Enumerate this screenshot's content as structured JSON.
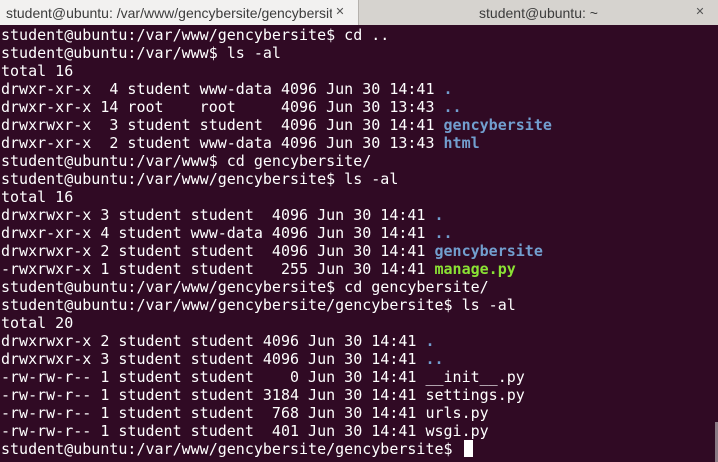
{
  "tabs": [
    {
      "label": "student@ubuntu: /var/www/gencybersite/gencybersite",
      "close": "✕",
      "active": true
    },
    {
      "label": "student@ubuntu: ~",
      "close": "✕",
      "active": false
    }
  ],
  "colors": {
    "background": "#300a24",
    "text": "#ffffff",
    "directory": "#729fcf",
    "executable": "#8ae234"
  },
  "terminal": {
    "lines": [
      {
        "type": "plain",
        "text": "student@ubuntu:/var/www/gencybersite$ cd .."
      },
      {
        "type": "plain",
        "text": "student@ubuntu:/var/www$ ls -al"
      },
      {
        "type": "plain",
        "text": "total 16"
      },
      {
        "type": "entry",
        "prefix": "drwxr-xr-x  4 student www-data 4096 Jun 30 14:41 ",
        "name": ".",
        "kind": "dir"
      },
      {
        "type": "entry",
        "prefix": "drwxr-xr-x 14 root    root     4096 Jun 30 13:43 ",
        "name": "..",
        "kind": "dir"
      },
      {
        "type": "entry",
        "prefix": "drwxrwxr-x  3 student student  4096 Jun 30 14:41 ",
        "name": "gencybersite",
        "kind": "dir"
      },
      {
        "type": "entry",
        "prefix": "drwxr-xr-x  2 student www-data 4096 Jun 30 13:43 ",
        "name": "html",
        "kind": "dir"
      },
      {
        "type": "plain",
        "text": "student@ubuntu:/var/www$ cd gencybersite/"
      },
      {
        "type": "plain",
        "text": "student@ubuntu:/var/www/gencybersite$ ls -al"
      },
      {
        "type": "plain",
        "text": "total 16"
      },
      {
        "type": "entry",
        "prefix": "drwxrwxr-x 3 student student  4096 Jun 30 14:41 ",
        "name": ".",
        "kind": "dir"
      },
      {
        "type": "entry",
        "prefix": "drwxr-xr-x 4 student www-data 4096 Jun 30 14:41 ",
        "name": "..",
        "kind": "dir"
      },
      {
        "type": "entry",
        "prefix": "drwxrwxr-x 2 student student  4096 Jun 30 14:41 ",
        "name": "gencybersite",
        "kind": "dir"
      },
      {
        "type": "entry",
        "prefix": "-rwxrwxr-x 1 student student   255 Jun 30 14:41 ",
        "name": "manage.py",
        "kind": "exec"
      },
      {
        "type": "plain",
        "text": "student@ubuntu:/var/www/gencybersite$ cd gencybersite/"
      },
      {
        "type": "plain",
        "text": "student@ubuntu:/var/www/gencybersite/gencybersite$ ls -al"
      },
      {
        "type": "plain",
        "text": "total 20"
      },
      {
        "type": "entry",
        "prefix": "drwxrwxr-x 2 student student 4096 Jun 30 14:41 ",
        "name": ".",
        "kind": "dir"
      },
      {
        "type": "entry",
        "prefix": "drwxrwxr-x 3 student student 4096 Jun 30 14:41 ",
        "name": "..",
        "kind": "dir"
      },
      {
        "type": "plain",
        "text": "-rw-rw-r-- 1 student student    0 Jun 30 14:41 __init__.py"
      },
      {
        "type": "plain",
        "text": "-rw-rw-r-- 1 student student 3184 Jun 30 14:41 settings.py"
      },
      {
        "type": "plain",
        "text": "-rw-rw-r-- 1 student student  768 Jun 30 14:41 urls.py"
      },
      {
        "type": "plain",
        "text": "-rw-rw-r-- 1 student student  401 Jun 30 14:41 wsgi.py"
      },
      {
        "type": "prompt",
        "text": "student@ubuntu:/var/www/gencybersite/gencybersite$ "
      }
    ]
  }
}
